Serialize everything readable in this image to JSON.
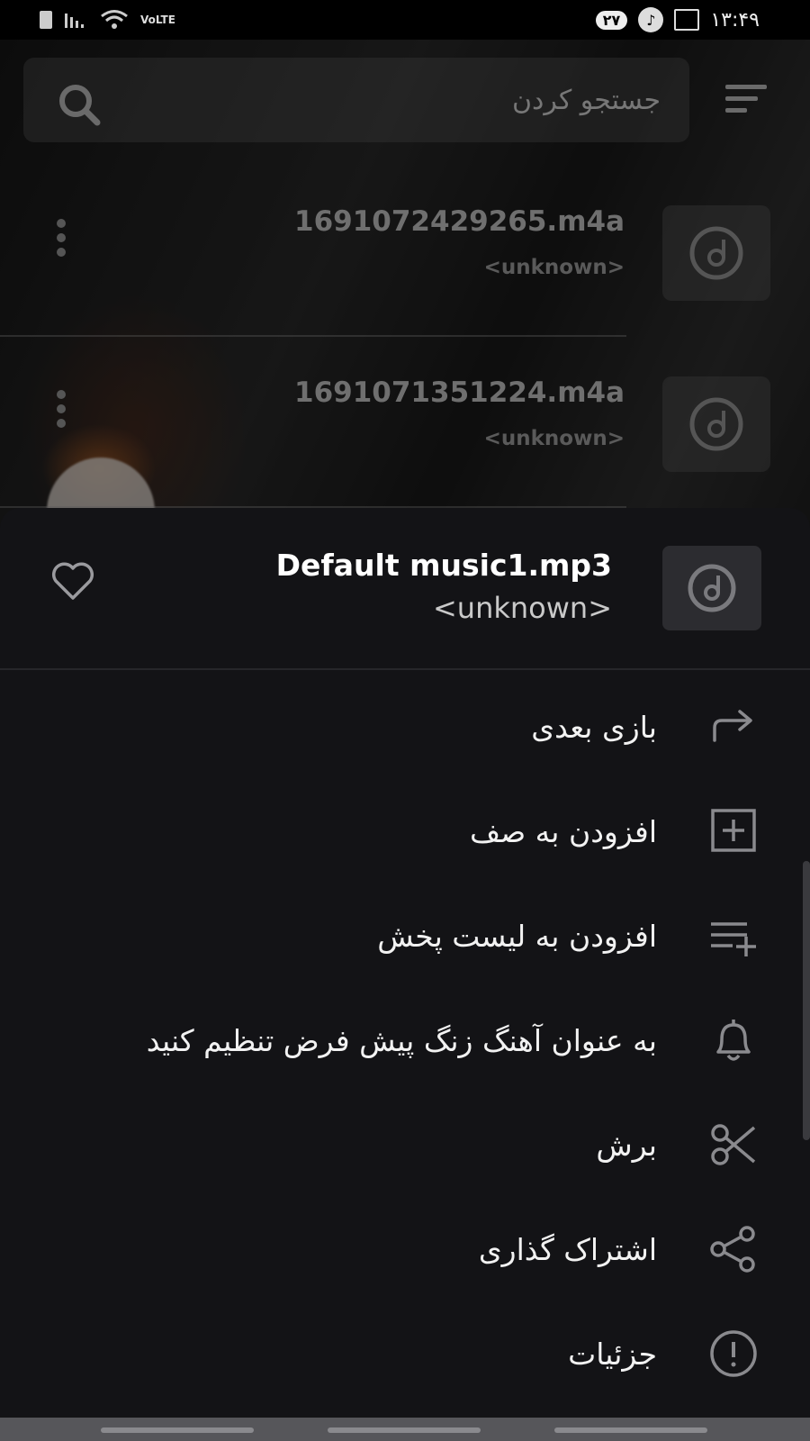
{
  "status_bar": {
    "lte": "VoLTE",
    "badge": "۲۷",
    "time": "۱۳:۴۹"
  },
  "search": {
    "placeholder": "جستجو کردن"
  },
  "tracks": [
    {
      "title": "1691072429265.m4a",
      "artist": "<unknown>"
    },
    {
      "title": "1691071351224.m4a",
      "artist": "<unknown>"
    }
  ],
  "sheet": {
    "title": "Default music1.mp3",
    "artist": "<unknown>",
    "items": [
      {
        "label": "بازی بعدی",
        "icon": "play-next-icon"
      },
      {
        "label": "افزودن به صف",
        "icon": "add-to-queue-icon"
      },
      {
        "label": "افزودن به لیست پخش",
        "icon": "add-to-playlist-icon"
      },
      {
        "label": "به عنوان آهنگ زنگ پیش فرض تنظیم کنید",
        "icon": "bell-icon"
      },
      {
        "label": "برش",
        "icon": "scissors-icon"
      },
      {
        "label": "اشتراک گذاری",
        "icon": "share-icon"
      },
      {
        "label": "جزئیات",
        "icon": "info-icon"
      }
    ]
  },
  "colors": {
    "sheet_bg": "#131316",
    "icon_gray": "#8a8a8e",
    "text_primary": "#ffffff"
  }
}
